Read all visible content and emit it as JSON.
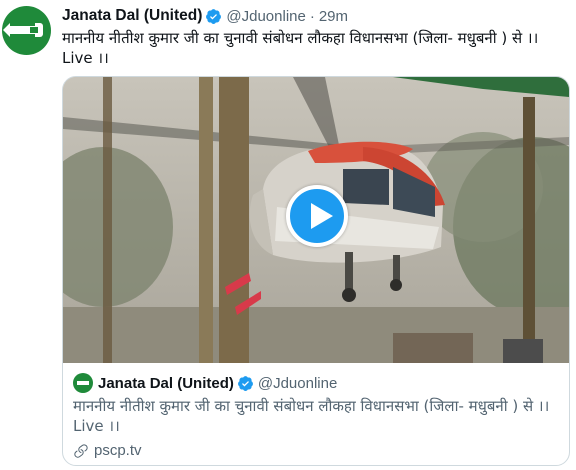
{
  "tweet": {
    "author_name": "Janata Dal (United)",
    "handle": "@Jduonline",
    "separator": "·",
    "time": "29m",
    "text": "माननीय नीतीश कुमार जी का चुनावी संबोधन लौकहा विधानसभा (जिला- मधुबनी ) से ।। Live ।।"
  },
  "card": {
    "author_name": "Janata Dal (United)",
    "handle": "@Jduonline",
    "text": "माननीय नीतीश कुमार जी का चुनावी संबोधन लौकहा विधानसभा (जिला- मधुबनी ) से ।। Live ।।",
    "link": "pscp.tv"
  },
  "icons": {
    "verified": "verified-badge-icon",
    "play": "play-icon",
    "link": "link-icon"
  },
  "colors": {
    "accent": "#1d9bf0",
    "brand_green": "#1f8a3a",
    "secondary_text": "#536471"
  }
}
